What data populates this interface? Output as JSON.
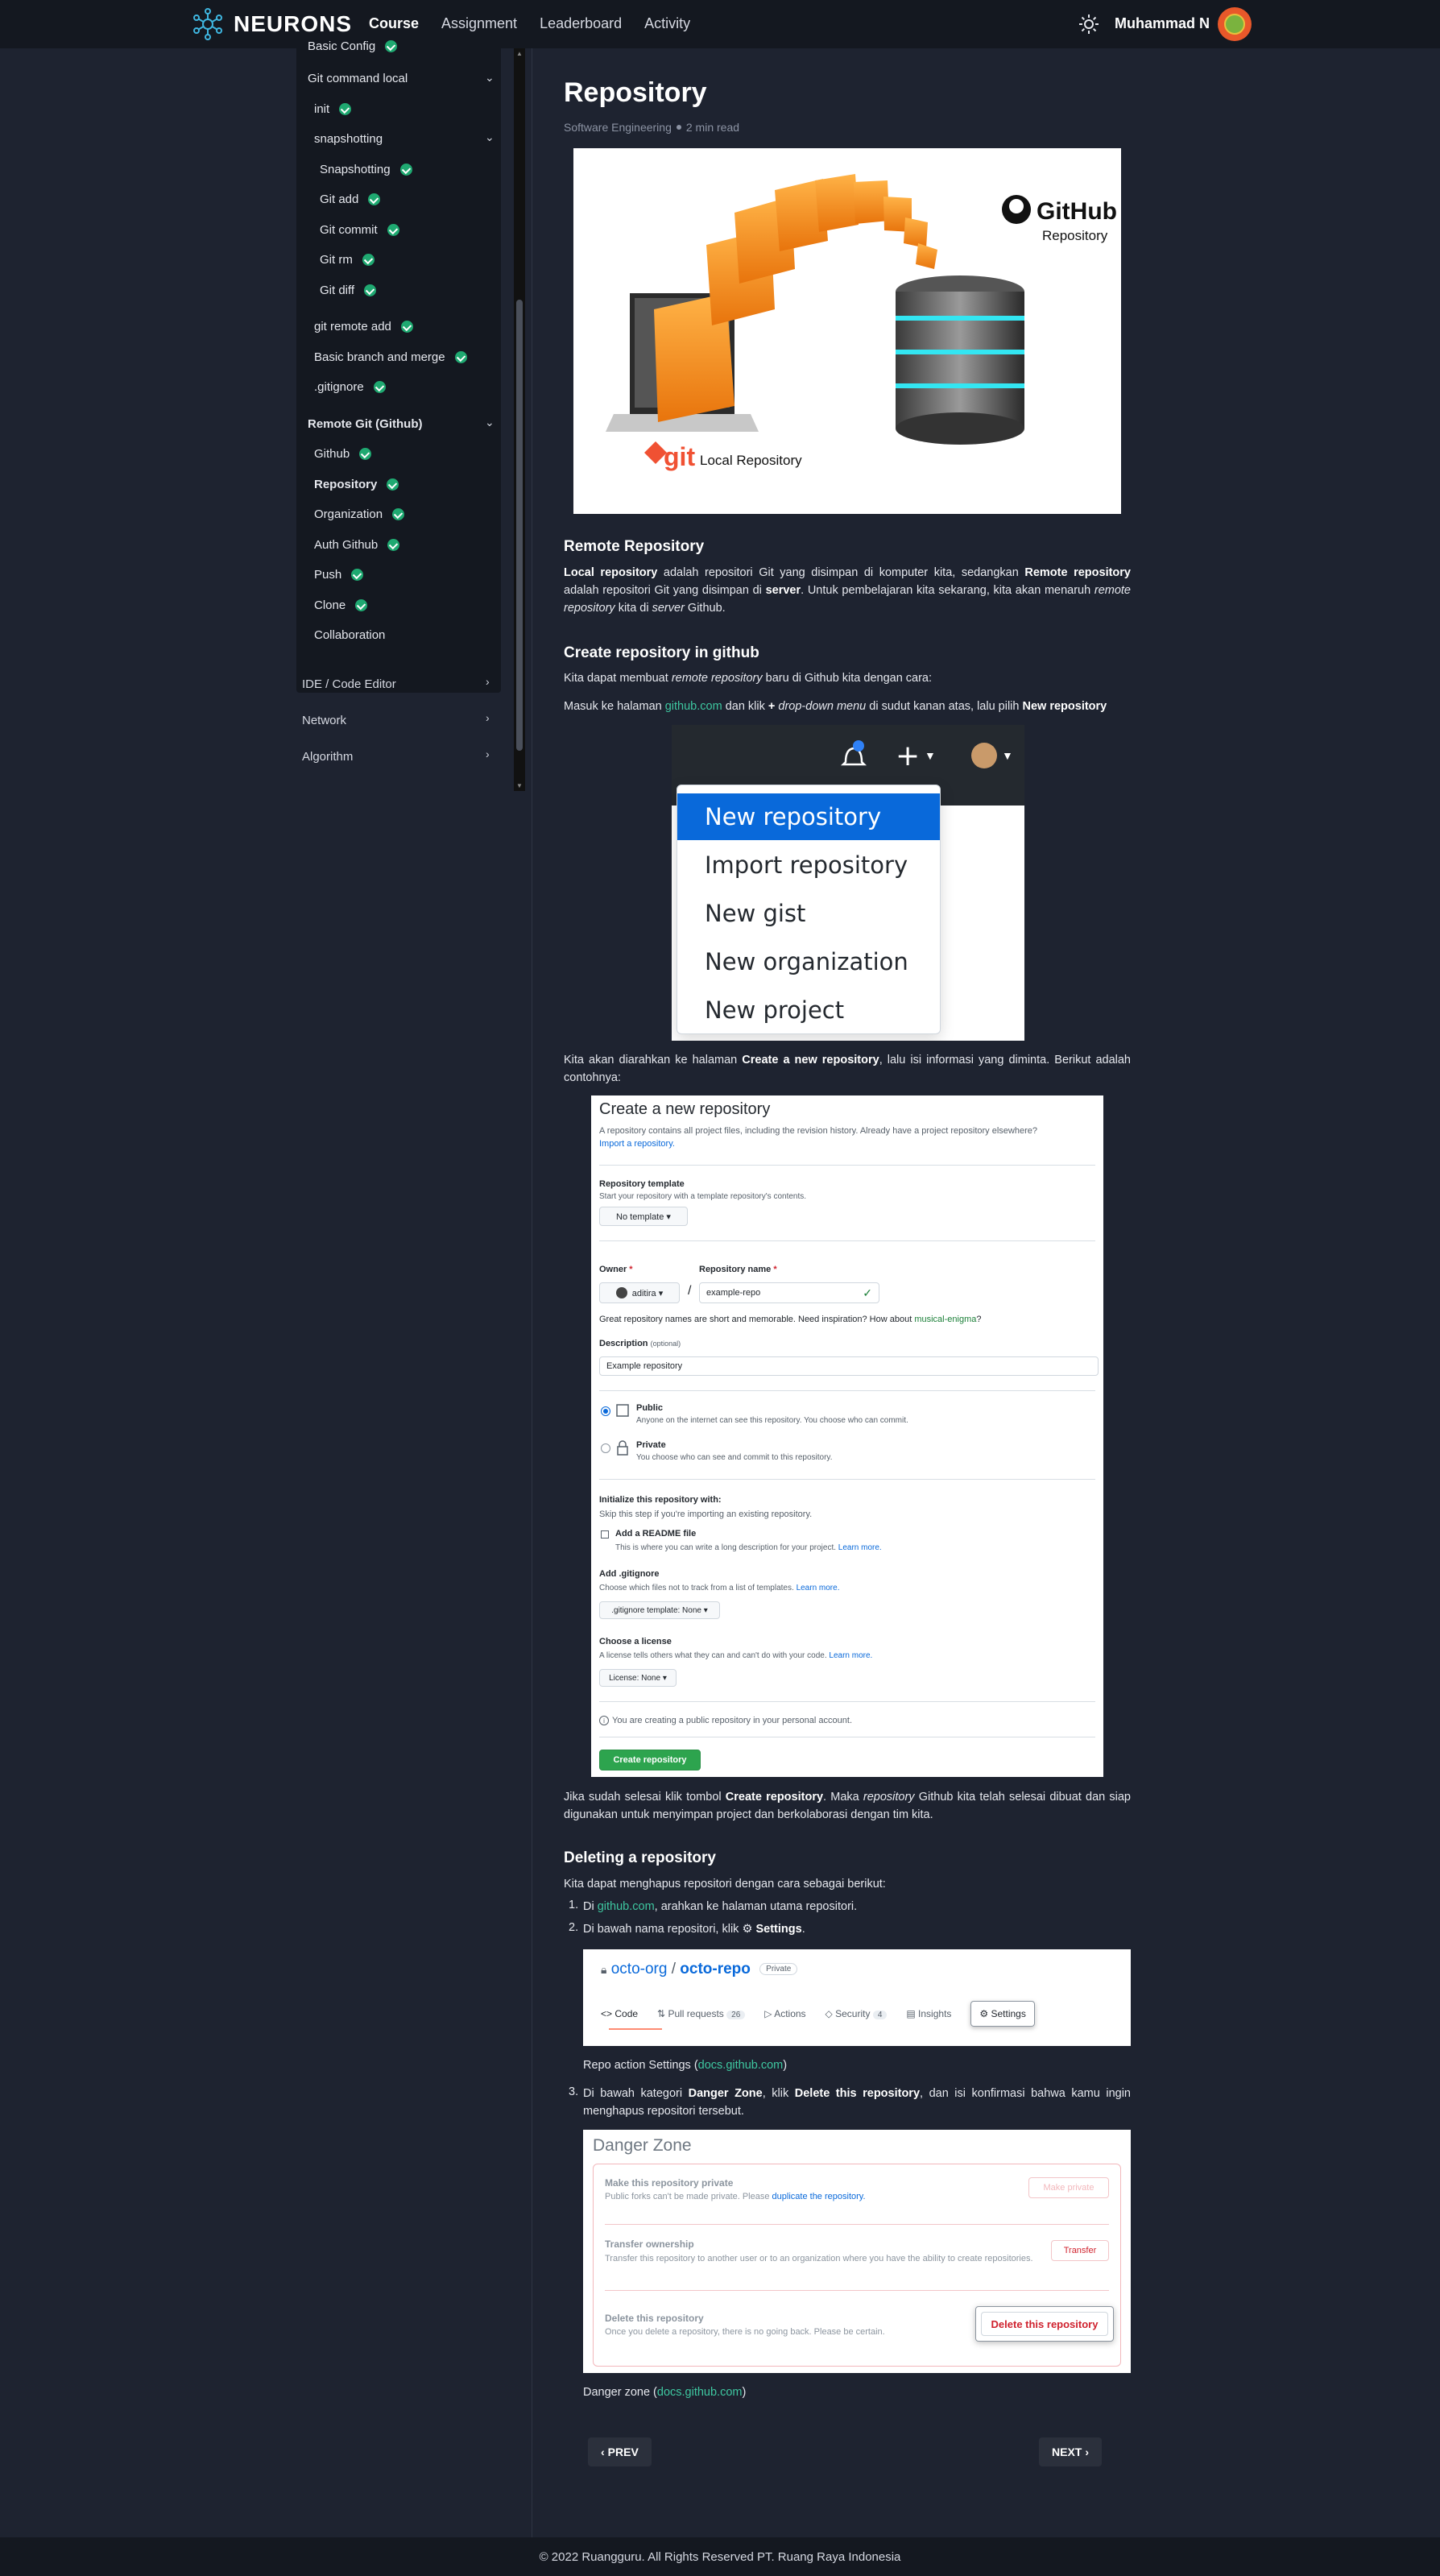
{
  "header": {
    "brand": "NEURONS",
    "nav": [
      "Course",
      "Assignment",
      "Leaderboard",
      "Activity"
    ],
    "active_nav": "Course",
    "user_name": "Muhammad N"
  },
  "sidebar": {
    "cut_item": "Basic Config",
    "git_local": {
      "label": "Git command local",
      "items": [
        "init",
        "snapshotting"
      ],
      "snapshotting": [
        "Snapshotting",
        "Git add",
        "Git commit",
        "Git rm",
        "Git diff"
      ],
      "more": [
        "git remote add",
        "Basic branch and merge",
        ".gitignore"
      ]
    },
    "remote_git": {
      "label": "Remote Git (Github)",
      "items": [
        "Github",
        "Repository",
        "Organization",
        "Auth Github",
        "Push",
        "Clone",
        "Collaboration"
      ],
      "active": "Repository"
    },
    "groups": [
      "IDE / Code Editor",
      "Network",
      "Algorithm"
    ]
  },
  "article": {
    "title": "Repository",
    "category": "Software Engineering",
    "read_time": "2 min read",
    "hero": {
      "brand": "GitHub",
      "brand_sub": "Repository",
      "git_word": "git",
      "git_sub": "Local Repository"
    },
    "sec1_title": "Remote Repository",
    "sec1_p": {
      "b1": "Local repository",
      "t1": " adalah repositori Git yang disimpan di komputer kita, sedangkan ",
      "b2": "Remote repository",
      "t2": " adalah repositori Git yang disimpan di ",
      "b3": "server",
      "t3": ". Untuk pembelajaran kita sekarang, kita akan menaruh ",
      "i1": "remote repository",
      "t4": " kita di ",
      "i2": "server",
      "t5": " Github."
    },
    "sec2_title": "Create repository in github",
    "sec2_p1": {
      "t1": "Kita dapat membuat ",
      "i1": "remote repository",
      "t2": " baru di Github kita dengan cara:"
    },
    "sec2_p2": {
      "t1": "Masuk ke halaman ",
      "link": "github.com",
      "t2": " dan klik ",
      "plus": "+",
      "i1": "drop-down menu",
      "t3": " di sudut kanan atas, lalu pilih ",
      "b1": "New repository"
    },
    "dropdown_items": [
      "New repository",
      "Import repository",
      "New gist",
      "New organization",
      "New project"
    ],
    "sec2_p3": {
      "t1": "Kita akan diarahkan ke halaman ",
      "b1": "Create a new repository",
      "t2": ", lalu isi informasi yang diminta. Berikut adalah contohnya:"
    },
    "create_form": {
      "title": "Create a new repository",
      "intro": "A repository contains all project files, including the revision history. Already have a project repository elsewhere?",
      "import_link": "Import a repository.",
      "template_label": "Repository template",
      "template_help": "Start your repository with a template repository's contents.",
      "template_btn": "No template ▾",
      "owner_label": "Owner",
      "name_label": "Repository name",
      "asterisk": "*",
      "owner_value": "aditira ▾",
      "slash": "/",
      "name_value": "example-repo",
      "name_hint": "Great repository names are short and memorable. Need inspiration? How about",
      "name_suggestion": "musical-enigma",
      "desc_label": "Description",
      "desc_optional": "(optional)",
      "desc_value": "Example repository",
      "public_label": "Public",
      "public_help": "Anyone on the internet can see this repository. You choose who can commit.",
      "private_label": "Private",
      "private_help": "You choose who can see and commit to this repository.",
      "init_label": "Initialize this repository with:",
      "init_help": "Skip this step if you're importing an existing repository.",
      "readme_label": "Add a README file",
      "readme_help": "This is where you can write a long description for your project.",
      "learn_more": "Learn more.",
      "gitignore_label": "Add .gitignore",
      "gitignore_help": "Choose which files not to track from a list of templates.",
      "gitignore_btn": ".gitignore template: None ▾",
      "license_label": "Choose a license",
      "license_help": "A license tells others what they can and can't do with your code.",
      "license_btn": "License: None ▾",
      "notice": "You are creating a public repository in your personal account.",
      "submit": "Create repository"
    },
    "sec2_p4": {
      "t1": "Jika sudah selesai klik tombol ",
      "b1": "Create repository",
      "t2": ". Maka ",
      "i1": "repository",
      "t3": " Github kita telah selesai dibuat dan siap digunakan untuk menyimpan project dan berkolaborasi dengan tim kita."
    },
    "sec3_title": "Deleting a repository",
    "sec3_p1": "Kita dapat menghapus repositori dengan cara sebagai berikut:",
    "steps": {
      "s1": {
        "n": "1.",
        "t1": "Di ",
        "link": "github.com",
        "t2": ", arahkan ke halaman utama repositori."
      },
      "s2": {
        "n": "2.",
        "t1": "Di bawah nama repositori, klik ",
        "b1": "Settings",
        "t2": "."
      },
      "s3": {
        "n": "3.",
        "t1": "Di bawah kategori ",
        "b1": "Danger Zone",
        "t2": ", klik ",
        "b2": "Delete this repository",
        "t3": ", dan isi konfirmasi bahwa kamu ingin menghapus repositori tersebut."
      }
    },
    "settings_shot": {
      "org": "octo-org",
      "slash": " / ",
      "repo": "octo-repo",
      "badge": "Private",
      "tabs": [
        "Code",
        "Pull requests",
        "Actions",
        "Security",
        "Insights",
        "Settings"
      ],
      "pr_count": "26",
      "sec_count": "4"
    },
    "settings_caption": {
      "t1": "Repo action Settings (",
      "link": "docs.github.com",
      "t2": ")"
    },
    "danger": {
      "title": "Danger Zone",
      "r1_title": "Make this repository private",
      "r1_desc": "Public forks can't be made private. Please",
      "r1_link": "duplicate the repository.",
      "r1_btn": "Make private",
      "r2_title": "Transfer ownership",
      "r2_desc": "Transfer this repository to another user or to an organization where you have the ability to create repositories.",
      "r2_btn": "Transfer",
      "r3_title": "Delete this repository",
      "r3_desc": "Once you delete a repository, there is no going back. Please be certain.",
      "r3_btn": "Delete this repository"
    },
    "danger_caption": {
      "t1": "Danger zone (",
      "link": "docs.github.com",
      "t2": ")"
    },
    "prev": "PREV",
    "next": "NEXT"
  },
  "footer": "© 2022 Ruangguru. All Rights Reserved PT. Ruang Raya Indonesia"
}
